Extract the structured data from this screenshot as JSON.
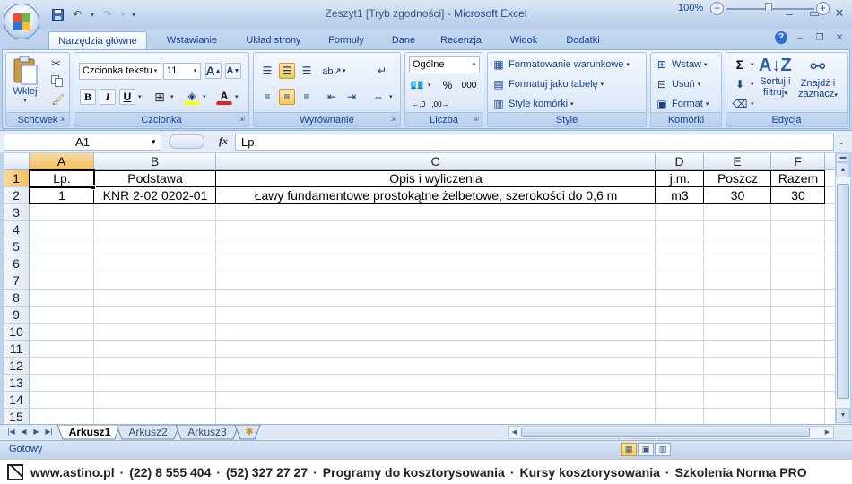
{
  "window": {
    "title_doc": "Zeszyt1  [Tryb zgodności]",
    "title_sep": " - ",
    "title_app": "Microsoft Excel"
  },
  "tabs": [
    {
      "label": "Narzędzia główne",
      "active": true
    },
    {
      "label": "Wstawianie"
    },
    {
      "label": "Układ strony"
    },
    {
      "label": "Formuły"
    },
    {
      "label": "Dane"
    },
    {
      "label": "Recenzja"
    },
    {
      "label": "Widok"
    },
    {
      "label": "Dodatki"
    }
  ],
  "ribbon": {
    "clipboard": {
      "title": "Schowek",
      "paste": "Wklej"
    },
    "font": {
      "title": "Czcionka",
      "name": "Czcionka tekstu",
      "size": "11",
      "bold": "B",
      "italic": "I",
      "underline": "U",
      "grow": "A",
      "shrink": "A",
      "color_letter": "A"
    },
    "alignment": {
      "title": "Wyrównanie"
    },
    "number": {
      "title": "Liczba",
      "format": "Ogólne",
      "percent": "%",
      "thousands": "000"
    },
    "styles": {
      "title": "Style",
      "conditional": "Formatowanie warunkowe",
      "as_table": "Formatuj jako tabelę",
      "cell_styles": "Style komórki"
    },
    "cells": {
      "title": "Komórki",
      "insert": "Wstaw",
      "delete": "Usuń",
      "format": "Format"
    },
    "editing": {
      "title": "Edycja",
      "sum": "Σ",
      "sort1": "Sortuj i",
      "sort2": "filtruj",
      "find1": "Znajdź i",
      "find2": "zaznacz"
    }
  },
  "formula_bar": {
    "name_box": "A1",
    "fx": "fx",
    "content": "Lp."
  },
  "sheet": {
    "columns": [
      "A",
      "B",
      "C",
      "D",
      "E",
      "F"
    ],
    "selected_column": "A",
    "row_numbers": [
      "1",
      "2",
      "3",
      "4",
      "5",
      "6",
      "7",
      "8",
      "9",
      "10",
      "11",
      "12",
      "13",
      "14",
      "15"
    ],
    "selected_row": "1",
    "header_row": [
      "Lp.",
      "Podstawa",
      "Opis i wyliczenia",
      "j.m.",
      "Poszcz",
      "Razem"
    ],
    "data_row": [
      "1",
      "KNR 2-02 0202-01",
      "Ławy fundamentowe prostokątne żelbetowe, szerokości do 0,6 m",
      "m3",
      "30",
      "30"
    ]
  },
  "sheet_tabs": [
    {
      "label": "Arkusz1",
      "active": true
    },
    {
      "label": "Arkusz2"
    },
    {
      "label": "Arkusz3"
    }
  ],
  "status": {
    "ready": "Gotowy",
    "zoom": "100%"
  },
  "footer": {
    "items": [
      "www.astino.pl",
      "(22) 8 555 404",
      "(52) 327 27 27",
      "Programy do kosztorysowania",
      "Kursy kosztorysowania",
      "Szkolenia Norma PRO"
    ],
    "separator": "·"
  },
  "colors": {
    "accent": "#15428b",
    "selection": "#f1c15f",
    "office_red": "#e94b2f",
    "office_green": "#6cbb3c",
    "office_blue": "#2f76d2",
    "office_yellow": "#f6c02c"
  }
}
